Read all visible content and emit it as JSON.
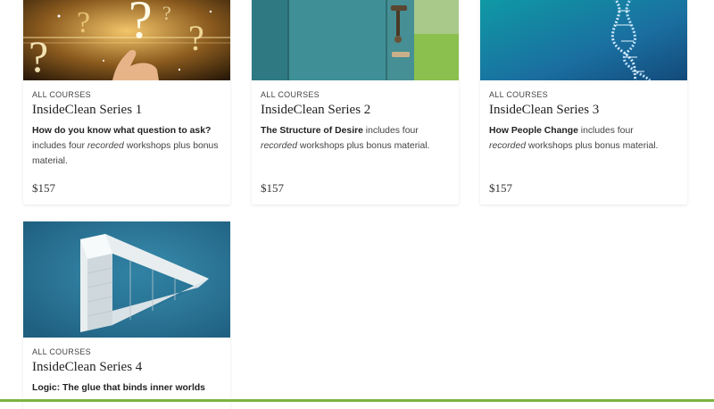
{
  "courses": [
    {
      "category": "ALL COURSES",
      "title": "InsideClean Series 1",
      "desc_bold": "How do you know what question to ask?",
      "desc_pre": "includes four ",
      "desc_italic": "recorded",
      "desc_post": " workshops plus bonus material.",
      "price": "$157",
      "image": "question-marks-image"
    },
    {
      "category": "ALL COURSES",
      "title": "InsideClean Series 2",
      "desc_bold": "The Structure of Desire",
      "desc_pre": " includes four ",
      "desc_italic": "recorded",
      "desc_post": " workshops plus bonus material.",
      "price": "$157",
      "image": "door-image"
    },
    {
      "category": "ALL COURSES",
      "title": "InsideClean Series 3",
      "desc_bold": "How People Change",
      "desc_pre": " includes four ",
      "desc_italic": "recorded",
      "desc_post": " workshops plus bonus material.",
      "price": "$157",
      "image": "dna-helix-image"
    },
    {
      "category": "ALL COURSES",
      "title": "InsideClean Series 4",
      "desc_bold": "Logic: The glue that binds inner worlds",
      "image": "impossible-triangle-image"
    }
  ],
  "colors": {
    "accent_bar": "#7cb342"
  }
}
